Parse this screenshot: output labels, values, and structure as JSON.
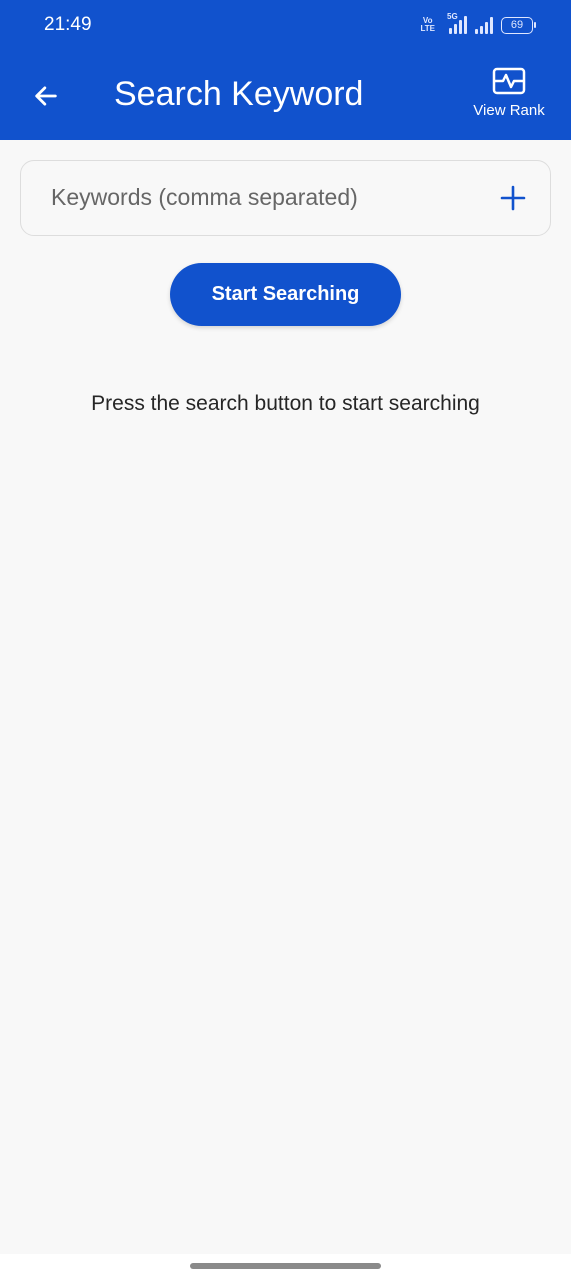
{
  "status_bar": {
    "time": "21:49",
    "network_label_top": "Vo",
    "network_label_bottom": "LTE",
    "network_5g": "5G",
    "battery": "69"
  },
  "app_bar": {
    "title": "Search Keyword",
    "back_icon": "arrow-left-icon",
    "view_rank_icon": "chart-pulse-icon",
    "view_rank_label": "View Rank"
  },
  "search": {
    "placeholder": "Keywords (comma separated)",
    "value": "",
    "add_icon": "plus-icon",
    "start_button_label": "Start Searching"
  },
  "hint": "Press the search button to start searching",
  "colors": {
    "primary": "#1152cd",
    "background": "#f8f8f8",
    "text": "#262626"
  }
}
